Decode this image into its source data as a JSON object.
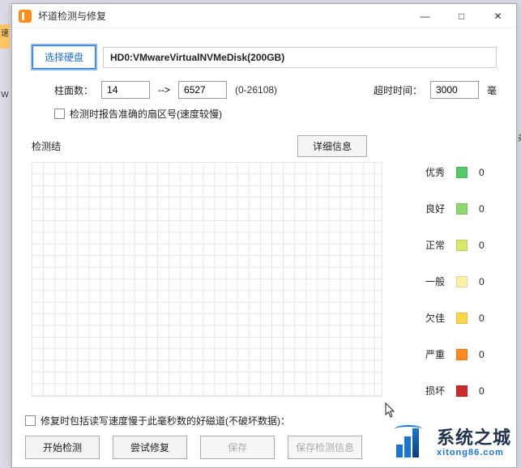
{
  "bg_window_title_fragment": "",
  "window": {
    "title": "坏道检测与修复",
    "controls": {
      "min": "—",
      "max": "□",
      "close": "✕"
    }
  },
  "select_disk_btn": "选择硬盘",
  "disk_name": "HD0:VMwareVirtualNVMeDisk(200GB)",
  "cylinder": {
    "label": "柱面数：",
    "start": "14",
    "arrow": "-->",
    "end": "6527",
    "range": "(0-26108)"
  },
  "timeout": {
    "label": "超时时间：",
    "value": "3000",
    "unit": "毫"
  },
  "opt_accurate_sector": "检测时报告准确的扇区号(速度较慢)",
  "result_label": "检测结",
  "detail_btn": "详细信息",
  "legend": [
    {
      "label": "优秀",
      "color": "#55c86a",
      "count": "0"
    },
    {
      "label": "良好",
      "color": "#8fd86f",
      "count": "0"
    },
    {
      "label": "正常",
      "color": "#d8e86a",
      "count": "0"
    },
    {
      "label": "一般",
      "color": "#fff2a8",
      "count": "0"
    },
    {
      "label": "欠佳",
      "color": "#ffd54a",
      "count": "0"
    },
    {
      "label": "严重",
      "color": "#ff8a1f",
      "count": "0"
    },
    {
      "label": "损坏",
      "color": "#cc2b2b",
      "count": "0"
    }
  ],
  "opt_repair_slow": "修复时包括读写速度慢于此毫秒数的好磁道(不破坏数据)：",
  "buttons": {
    "start": "开始检测",
    "repair": "尝试修复",
    "save": "保存",
    "save_info": "保存检测信息"
  },
  "watermark": {
    "cn": "系统之城",
    "en": "xitong86.com"
  },
  "left_badge": "速",
  "left_badge2": "W",
  "right_badge": "弟"
}
